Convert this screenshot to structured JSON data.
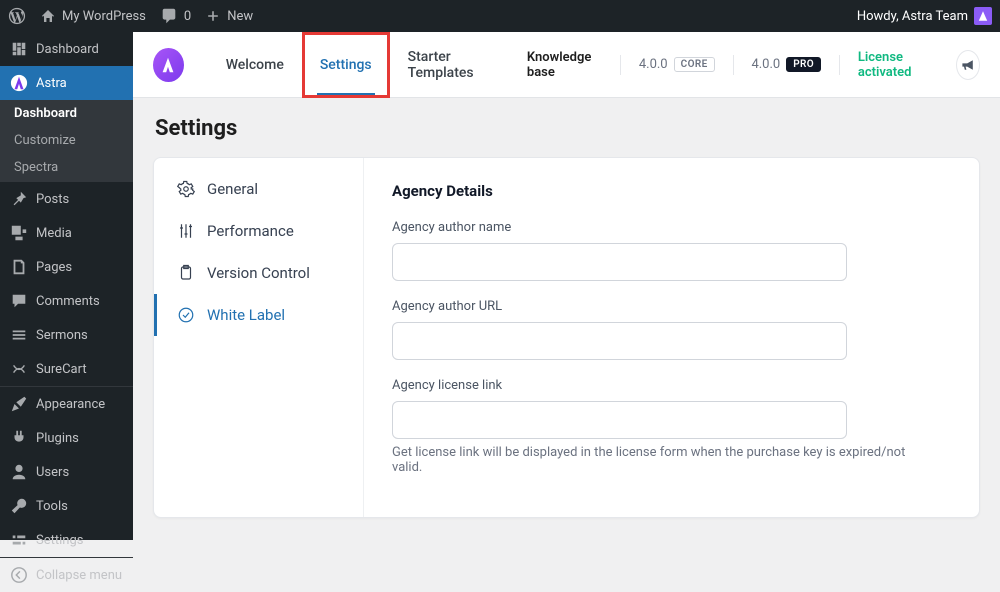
{
  "adminbar": {
    "site_name": "My WordPress",
    "comments_count": "0",
    "new_label": "New",
    "howdy": "Howdy, Astra Team"
  },
  "sidemenu": {
    "items": [
      {
        "id": "dashboard",
        "label": "Dashboard"
      },
      {
        "id": "astra",
        "label": "Astra",
        "active": true
      }
    ],
    "astra_sub": [
      {
        "label": "Dashboard",
        "active": true
      },
      {
        "label": "Customize"
      },
      {
        "label": "Spectra"
      }
    ],
    "rest": [
      {
        "label": "Posts"
      },
      {
        "label": "Media"
      },
      {
        "label": "Pages"
      },
      {
        "label": "Comments"
      },
      {
        "label": "Sermons"
      },
      {
        "label": "SureCart"
      }
    ],
    "lower": [
      {
        "label": "Appearance"
      },
      {
        "label": "Plugins"
      },
      {
        "label": "Users"
      },
      {
        "label": "Tools"
      },
      {
        "label": "Settings"
      }
    ],
    "collapse": "Collapse menu"
  },
  "topbar": {
    "tabs": [
      {
        "label": "Welcome"
      },
      {
        "label": "Settings",
        "active": true,
        "highlight": true
      },
      {
        "label": "Starter Templates"
      }
    ],
    "knowledge_base": "Knowledge base",
    "core_version": "4.0.0",
    "core_badge": "CORE",
    "pro_version": "4.0.0",
    "pro_badge": "PRO",
    "license_status": "License activated"
  },
  "page": {
    "title": "Settings",
    "side_tabs": [
      {
        "label": "General"
      },
      {
        "label": "Performance"
      },
      {
        "label": "Version Control"
      },
      {
        "label": "White Label",
        "active": true
      }
    ],
    "section_heading": "Agency Details",
    "fields": {
      "author_name": {
        "label": "Agency author name",
        "value": ""
      },
      "author_url": {
        "label": "Agency author URL",
        "value": ""
      },
      "license_link": {
        "label": "Agency license link",
        "value": "",
        "help": "Get license link will be displayed in the license form when the purchase key is expired/not valid."
      }
    }
  }
}
